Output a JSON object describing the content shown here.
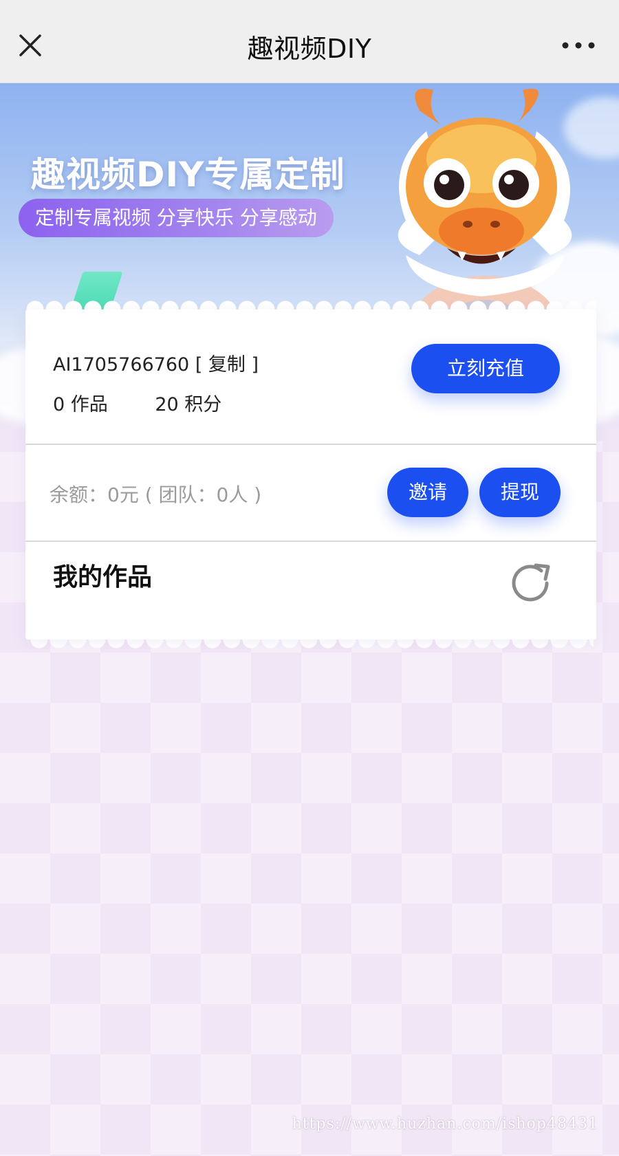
{
  "header": {
    "title": "趣视频DIY",
    "close_icon": "close-icon",
    "more_icon": "more-icon"
  },
  "banner": {
    "title": "趣视频DIY专属定制",
    "subtitle": "定制专属视频 分享快乐 分享感动",
    "mascot": "dragon-mascot-icon"
  },
  "account": {
    "user_id": "AI1705766760",
    "copy_label": "[ 复制 ]",
    "works_count": "0 作品",
    "points": "20 积分",
    "recharge_label": "立刻充值"
  },
  "wallet": {
    "balance_text": "余额：0元 ( 团队：0人 )",
    "invite_label": "邀请",
    "withdraw_label": "提现"
  },
  "works": {
    "title": "我的作品",
    "refresh_icon": "refresh-icon"
  },
  "watermark": "https://www.huzhan.com/ishop48431",
  "colors": {
    "primary_button": "#1c4ff0",
    "banner_pill": "#9a74ee",
    "page_background": "#f1e6f6"
  }
}
